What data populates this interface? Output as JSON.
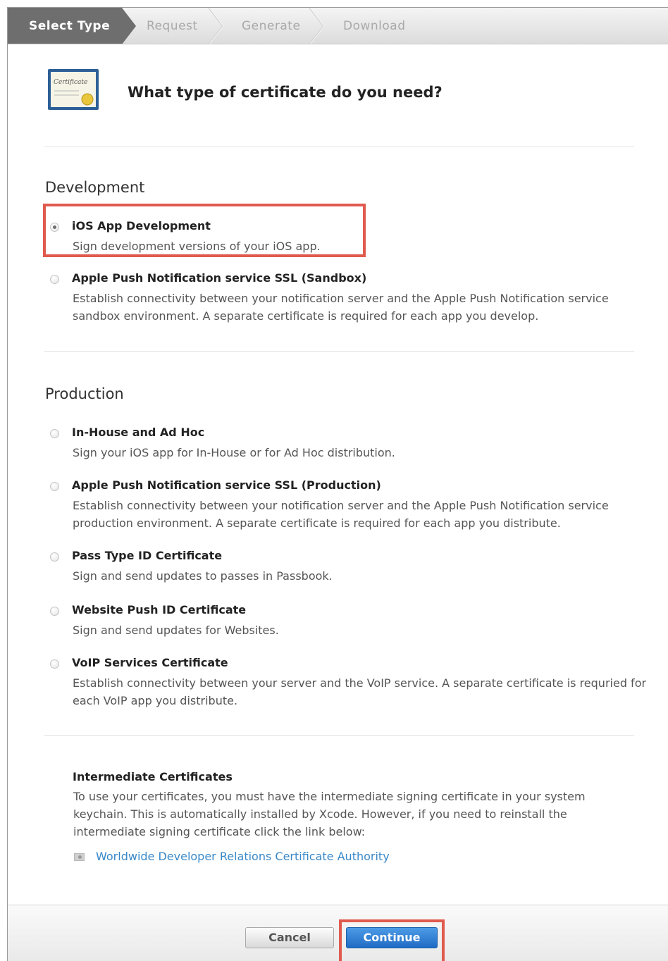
{
  "steps": [
    {
      "label": "Select Type",
      "active": true
    },
    {
      "label": "Request",
      "active": false
    },
    {
      "label": "Generate",
      "active": false
    },
    {
      "label": "Download",
      "active": false
    }
  ],
  "header": {
    "icon": "certificate-icon",
    "icon_text": "Certificate",
    "title": "What type of certificate do you need?"
  },
  "development": {
    "title": "Development",
    "options": [
      {
        "title": "iOS App Development",
        "desc": "Sign development versions of your iOS app.",
        "checked": true
      },
      {
        "title": "Apple Push Notification service SSL (Sandbox)",
        "desc": "Establish connectivity between your notification server and the Apple Push Notification service sandbox environment. A separate certificate is required for each app you develop.",
        "checked": false
      }
    ]
  },
  "production": {
    "title": "Production",
    "options": [
      {
        "title": "In-House and Ad Hoc",
        "desc": "Sign your iOS app for In-House or for Ad Hoc distribution.",
        "checked": false
      },
      {
        "title": "Apple Push Notification service SSL (Production)",
        "desc": "Establish connectivity between your notification server and the Apple Push Notification service production environment. A separate certificate is required for each app you distribute.",
        "checked": false
      },
      {
        "title": "Pass Type ID Certificate",
        "desc": "Sign and send updates to passes in Passbook.",
        "checked": false
      },
      {
        "title": "Website Push ID Certificate",
        "desc": "Sign and send updates for Websites.",
        "checked": false
      },
      {
        "title": "VoIP Services Certificate",
        "desc": "Establish connectivity between your server and the VoIP service. A separate certificate is requried for each VoIP app you distribute.",
        "checked": false
      }
    ]
  },
  "intermediate": {
    "title": "Intermediate Certificates",
    "text": "To use your certificates, you must have the intermediate signing certificate in your system keychain. This is automatically installed by Xcode. However, if you need to reinstall the intermediate signing certificate click the link below:",
    "link": "Worldwide Developer Relations Certificate Authority"
  },
  "footer": {
    "cancel_label": "Cancel",
    "continue_label": "Continue"
  },
  "colors": {
    "highlight": "#e05a4e",
    "link": "#3a88c8",
    "primary_button": "#1f6bc4"
  }
}
